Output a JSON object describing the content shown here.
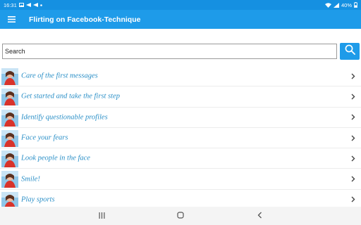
{
  "status_bar": {
    "time": "16:31",
    "battery": "40%"
  },
  "app_bar": {
    "title": "Flirting on Facebook-Technique"
  },
  "search": {
    "placeholder": "Search",
    "value": ""
  },
  "list": {
    "items": [
      {
        "label": "Care of the first messages"
      },
      {
        "label": "Get started and take the first step"
      },
      {
        "label": "Identify questionable profiles"
      },
      {
        "label": "Face your fears"
      },
      {
        "label": "Look people in the face"
      },
      {
        "label": "Smile!"
      },
      {
        "label": "Play sports"
      }
    ]
  },
  "colors": {
    "accent": "#1e9be9",
    "status_bar": "#1590e1",
    "item_text": "#2a8fc7"
  }
}
